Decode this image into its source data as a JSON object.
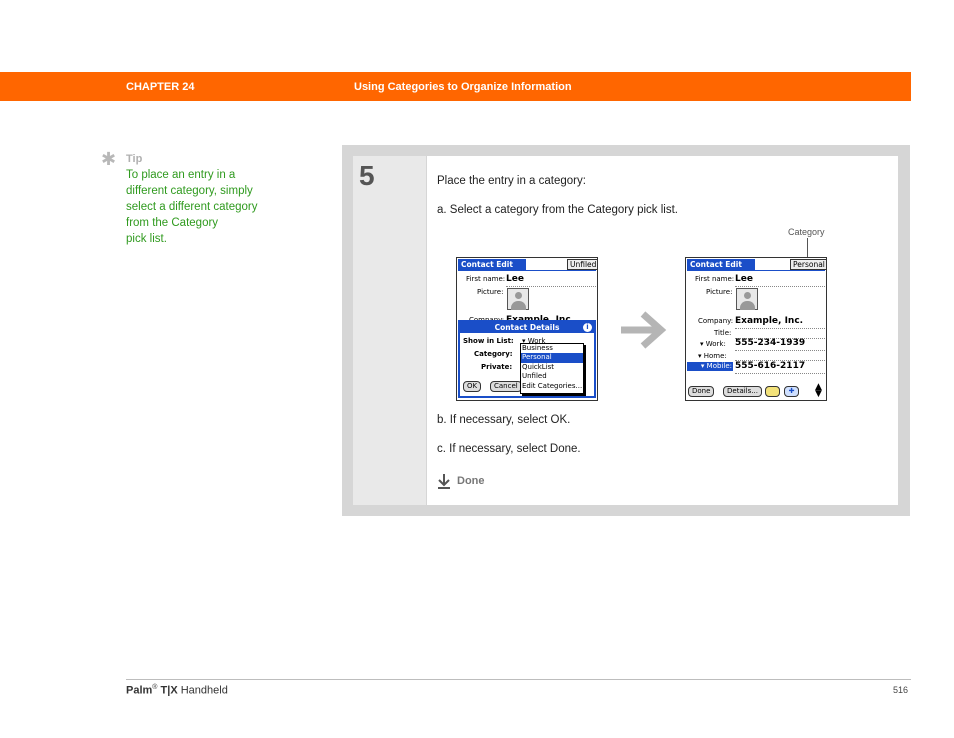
{
  "header": {
    "chapter": "CHAPTER 24",
    "title": "Using Categories to Organize Information",
    "bar_color": "#ff6600"
  },
  "tip": {
    "label": "Tip",
    "lines": [
      "To place an entry in a",
      "different category, simply",
      "select a different category",
      "from the Category",
      "pick list."
    ]
  },
  "step": {
    "number": "5",
    "intro": "Place the entry in a category:",
    "sub_a": "a.  Select a category from the Category pick list.",
    "sub_b": "b.  If necessary, select OK.",
    "sub_c": "c.  If necessary, select Done.",
    "done_label": "Done",
    "callout": "Category"
  },
  "screen_left": {
    "title": "Contact Edit",
    "category": "Unfiled",
    "first_name_label": "First name:",
    "first_name": "Lee",
    "picture_label": "Picture:",
    "company_label": "Company:",
    "company_partial": "Example, Inc.",
    "dialog": {
      "title": "Contact Details",
      "show_in_list_label": "Show in List:",
      "show_in_list_value": "Work",
      "category_label": "Category:",
      "private_label": "Private:",
      "ok": "OK",
      "cancel": "Cancel",
      "options": [
        "Business",
        "Personal",
        "QuickList",
        "Unfiled",
        "Edit Categories..."
      ],
      "selected": "Personal"
    }
  },
  "screen_right": {
    "title": "Contact Edit",
    "category": "Personal",
    "first_name_label": "First name:",
    "first_name": "Lee",
    "picture_label": "Picture:",
    "company_label": "Company:",
    "company": "Example, Inc.",
    "title_label": "Title:",
    "work_label": "Work:",
    "work": "555-234-1939",
    "home_label": "Home:",
    "mobile_label": "Mobile:",
    "mobile": "555-616-2117",
    "done_btn": "Done",
    "details_btn": "Details..."
  },
  "footer": {
    "brand": "Palm",
    "reg": "®",
    "model": " T|X",
    "product": " Handheld",
    "page": "516"
  }
}
